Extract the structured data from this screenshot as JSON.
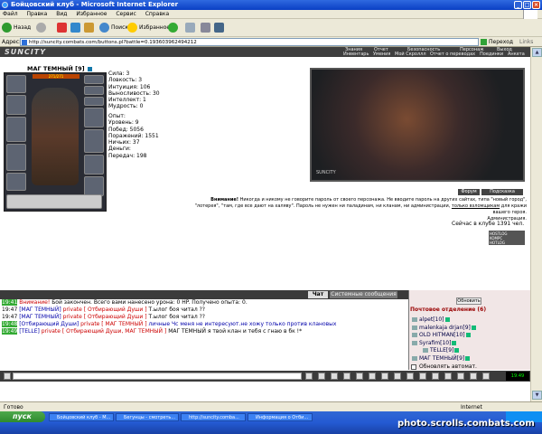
{
  "window": {
    "title": "Бойцовский клуб - Microsoft Internet Explorer"
  },
  "menubar": [
    "Файл",
    "Правка",
    "Вид",
    "Избранное",
    "Сервис",
    "Справка"
  ],
  "toolbar": {
    "back": "Назад",
    "search": "Поиск",
    "favorites": "Избранное"
  },
  "address": {
    "label": "Адрес:",
    "url": "http://suncity.combats.com/buttons.pl?battle=0.193603962494212",
    "go": "Переход",
    "links": "Links"
  },
  "topnav": {
    "logo": "SUNCITY",
    "row1": [
      "Знания",
      "Отчет",
      "Безопасность",
      "Персонаж",
      "Выход"
    ],
    "row2": [
      "Инвентарь",
      "Умения",
      "Мой Скроллл",
      "Отчет о переводах",
      "Поединки",
      "Анкета"
    ]
  },
  "character": {
    "name": "МАГ ТЕМНЫЙ",
    "level": "[9]",
    "hp": "271/271",
    "stats": [
      "Сила: 3",
      "Ловкость: 3",
      "Интуиция: 106",
      "Выносливость: 30",
      "Интеллект: 1",
      "Мудрость: 0"
    ],
    "info": [
      "Опыт:",
      "Уровень: 9",
      "Побед: 5056",
      "Поражений: 1551",
      "Ничьих: 37",
      "Деньги:",
      "Передач: 198"
    ]
  },
  "arena": {
    "label": "SUNCITY"
  },
  "buttons": {
    "forum": "Форум",
    "help": "Подсказка",
    "refresh": "Обновить"
  },
  "warning": {
    "bold": "Внимание!",
    "line1": "Никогда и никому не говорите пароль от своего персонажа. Не вводите пароль на других сайтах, типа \"новый город\",",
    "line2": "\"лотерея\", \"там, где все дают на халяву\". Пароль не нужен ни паладинам, ни кланам, ни администрации,",
    "link": "только взломщикам",
    "line2end": "для кражи",
    "line3": "вашего героя.",
    "line4": "Администрация."
  },
  "online": "Сейчас в клубе 1391 чел.",
  "counter": [
    "HOSTLOG",
    "KOMPC",
    "HOTLOG"
  ],
  "chat": {
    "tabs": [
      "Чат",
      "Системные сообщения"
    ],
    "lines": [
      {
        "time": "19:41",
        "highlight": true,
        "segments": [
          {
            "t": "Внимание! ",
            "c": "sys"
          },
          {
            "t": "Бой закончен. Всего вами нанесено урона: ",
            "c": "tm"
          },
          {
            "t": "0 HP",
            "c": "tm"
          },
          {
            "t": ". Получено опыта: ",
            "c": "tm"
          },
          {
            "t": "0",
            "c": "tm"
          },
          {
            "t": ".",
            "c": "tm"
          }
        ]
      },
      {
        "time": "19:47",
        "highlight": false,
        "segments": [
          {
            "t": "[МАГ ТЕМНЫЙ] ",
            "c": "nm"
          },
          {
            "t": "private [ Отбирающий Души ]",
            "c": "pv"
          },
          {
            "t": " Т.ылог боя читал ??",
            "c": "tm"
          }
        ]
      },
      {
        "time": "19:47",
        "highlight": false,
        "segments": [
          {
            "t": "[МАГ ТЕМНЫЙ] ",
            "c": "nm"
          },
          {
            "t": "private [ Отбирающий Души ]",
            "c": "pv"
          },
          {
            "t": " Т.ылог боя читал ??",
            "c": "tm"
          }
        ]
      },
      {
        "time": "19:48",
        "highlight": true,
        "segments": [
          {
            "t": "[Отбирающий Души] ",
            "c": "nm"
          },
          {
            "t": "private [ МАГ ТЕМНЫЙ ]",
            "c": "pv"
          },
          {
            "t": " личные Чс меня не интересуют.не хожу только против клановых",
            "c": "nm"
          }
        ]
      },
      {
        "time": "19:49",
        "highlight": true,
        "segments": [
          {
            "t": "[TELLE] ",
            "c": "nm"
          },
          {
            "t": "private [ Отбирающий Души, МАГ ТЕМНЫЙ ]",
            "c": "pv"
          },
          {
            "t": " МАГ ТЕМНЫЙ я твой клан и тебя с гнаю в бк !*",
            "c": "tm"
          }
        ]
      }
    ]
  },
  "mail": {
    "title": "Почтовое отделение (6)",
    "users": [
      "alpet[10]",
      "malenkaja drjan[9]",
      "OLD HITMAN[10]",
      "Syrafim[10]",
      "TELLE[9]",
      "МАГ ТЕМНЫЙ[9]"
    ],
    "autorefresh": "Обновлять автомат."
  },
  "clock": "19:49",
  "statusbar": {
    "status": "Готово",
    "zone": "Internet"
  },
  "taskbar": {
    "start": "пуск",
    "tasks": [
      "Бойцовский клуб - M...",
      "Бегунцы - смотреть...",
      "http://suncity.comba...",
      "Информация о Отби..."
    ],
    "watermark": "photo.scrolls.combats.com"
  },
  "colors": {
    "accent": "#2f6ae0",
    "chat_bg": "#3b3b3b",
    "private": "#cc0000"
  }
}
